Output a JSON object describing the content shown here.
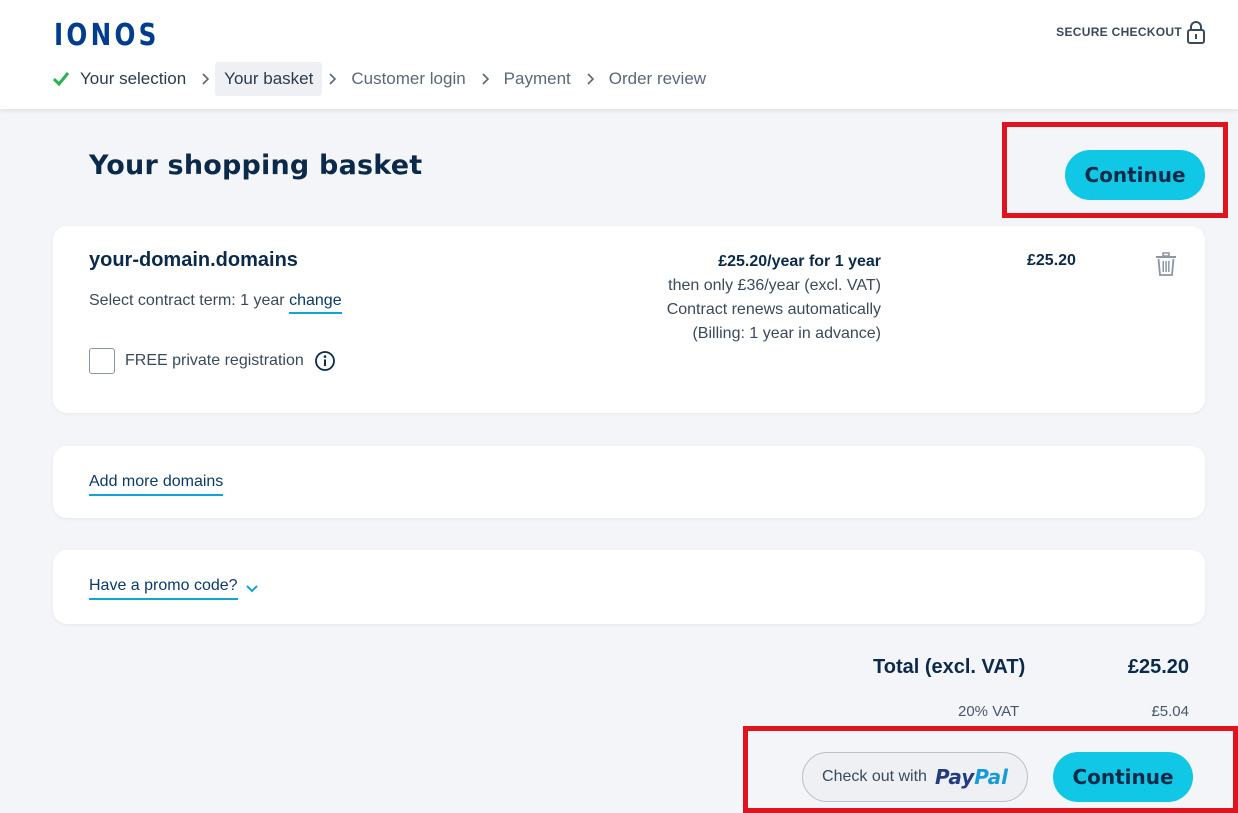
{
  "header": {
    "logo": "IONOS",
    "secure_checkout": "SECURE CHECKOUT",
    "steps": [
      {
        "label": "Your selection",
        "state": "done"
      },
      {
        "label": "Your basket",
        "state": "current"
      },
      {
        "label": "Customer login",
        "state": "upcoming"
      },
      {
        "label": "Payment",
        "state": "upcoming"
      },
      {
        "label": "Order review",
        "state": "upcoming"
      }
    ]
  },
  "main": {
    "title": "Your shopping basket",
    "continue_label": "Continue"
  },
  "basket_item": {
    "domain": "your-domain.domains",
    "term_prefix": "Select contract term: 1 year",
    "change_link": "change",
    "private_registration": "FREE private registration",
    "private_registration_checked": false,
    "price_line_1": "£25.20/year for 1 year",
    "price_line_2": "then only £36/year (excl. VAT)",
    "price_line_3": "Contract renews automatically",
    "price_line_4": "(Billing: 1 year in advance)",
    "price": "£25.20"
  },
  "add_more": {
    "label": "Add more domains"
  },
  "promo": {
    "label": "Have a promo code?"
  },
  "summary": {
    "total_label": "Total (excl. VAT)",
    "total_value": "£25.20",
    "vat_label": "20% VAT",
    "vat_value": "£5.04"
  },
  "footer_actions": {
    "paypal_prefix": "Check out with",
    "paypal_brand_1": "Pay",
    "paypal_brand_2": "Pal",
    "continue_label": "Continue"
  },
  "colors": {
    "accent": "#11c7e6",
    "brand": "#003d8f",
    "highlight": "#e0131f",
    "check": "#2bb24c"
  }
}
